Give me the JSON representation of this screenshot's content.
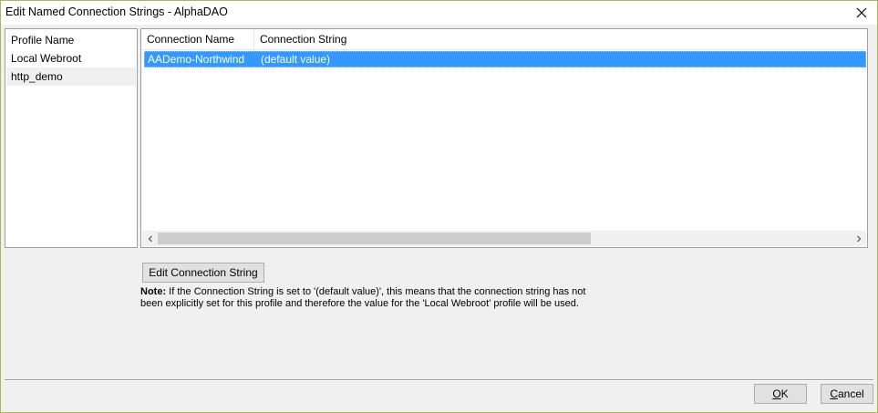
{
  "window": {
    "title": "Edit Named Connection Strings - AlphaDAO",
    "close_icon": "close-icon"
  },
  "profiles": {
    "header": "Profile Name",
    "items": [
      {
        "label": "Local Webroot",
        "selected": false
      },
      {
        "label": "http_demo",
        "selected": true
      }
    ]
  },
  "grid": {
    "columns": [
      "Connection Name",
      "Connection String"
    ],
    "rows": [
      {
        "name": "AADemo-Northwind",
        "value": "(default value)",
        "selected": true
      }
    ]
  },
  "buttons": {
    "edit_label": "Edit Connection String",
    "ok_label": "OK",
    "cancel_label": "Cancel"
  },
  "note": {
    "label": "Note:",
    "text": "If the Connection String is set to '(default value)', this means that the connection string has not been explicitly set for this profile and therefore the value for the 'Local Webroot' profile will be used."
  },
  "colors": {
    "selection": "#3399ff",
    "window_border": "#a8b85a"
  }
}
